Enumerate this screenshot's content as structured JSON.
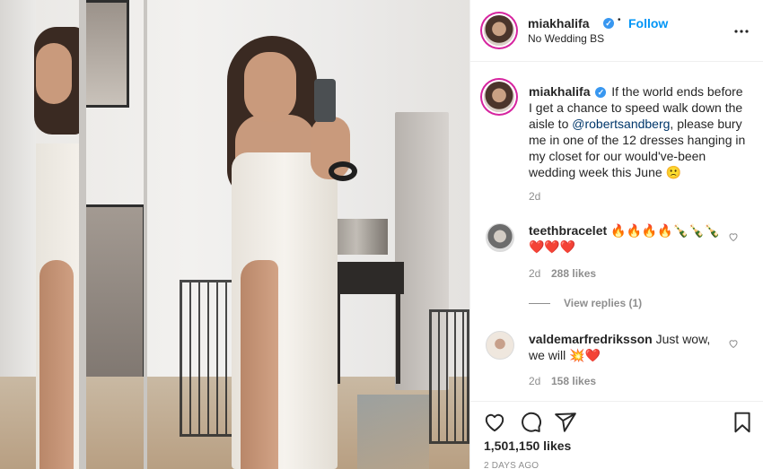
{
  "post": {
    "author": "miakhalifa",
    "follow_label": "Follow",
    "separator": "•",
    "location": "No Wedding BS",
    "more_label": "•••"
  },
  "caption": {
    "username": "miakhalifa",
    "text_before_mention": "If the world ends before I get a chance to speed walk down the aisle to ",
    "mention": "@robertsandberg",
    "text_after_mention": ", please bury me in one of the 12 dresses hanging in my closet for our would've-been wedding week this June 🙁",
    "age": "2d"
  },
  "comments": [
    {
      "username": "teethbracelet",
      "text": "🔥🔥🔥🔥🍾🍾🍾 ❤️❤️❤️",
      "age": "2d",
      "likes": "288 likes",
      "view_replies": "View replies (1)"
    },
    {
      "username": "valdemarfredriksson",
      "text": "Just wow, we will 💥❤️",
      "age": "2d",
      "likes": "158 likes"
    }
  ],
  "footer": {
    "likes": "1,501,150 likes",
    "time": "2 DAYS AGO"
  },
  "icons": [
    "verified-badge-icon",
    "more-options-icon",
    "heart-icon",
    "comment-icon",
    "share-icon",
    "save-icon",
    "like-comment-icon"
  ],
  "colors": {
    "link": "#0095f6",
    "mention": "#00376b",
    "muted": "#8e8e8e",
    "verified": "#3897f0"
  }
}
